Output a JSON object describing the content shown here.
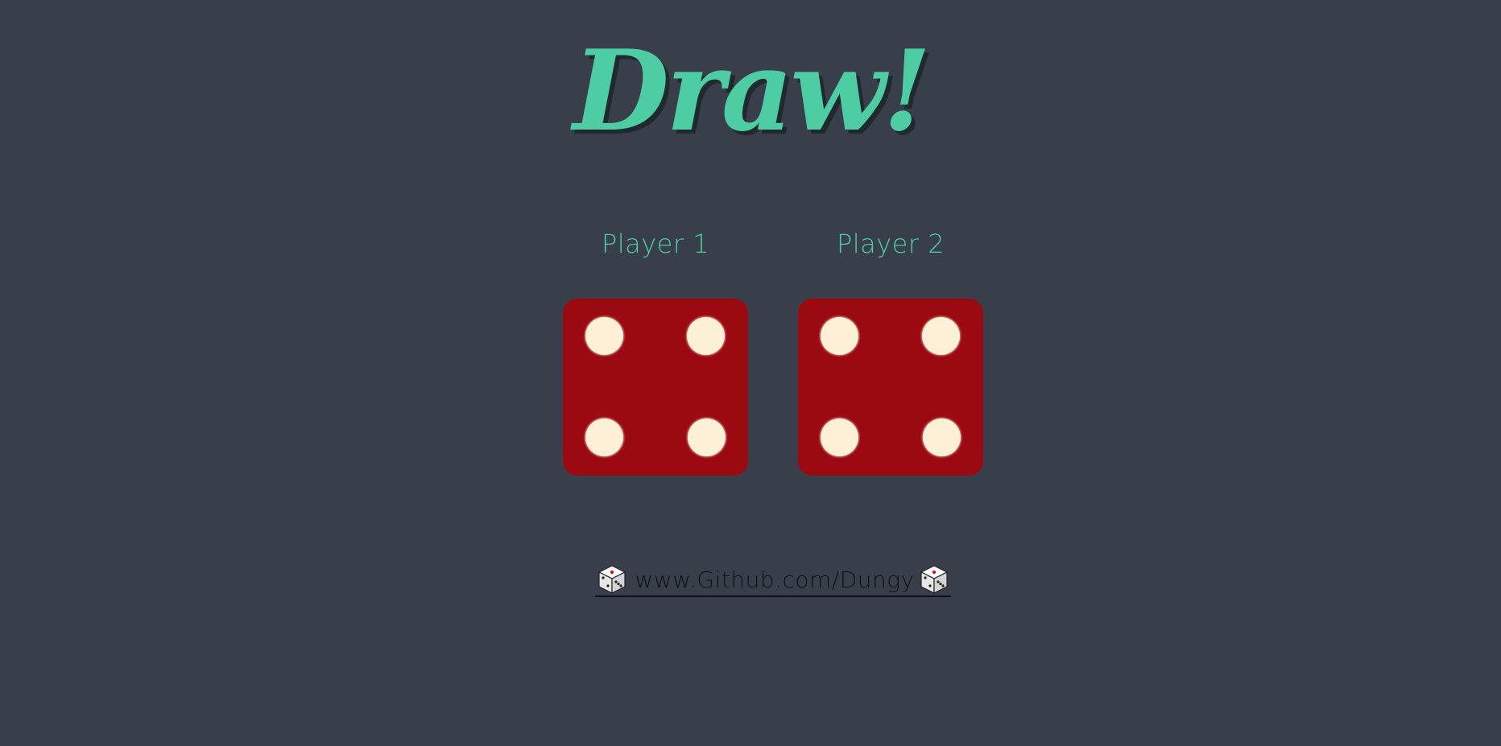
{
  "header": {
    "title": "Draw!"
  },
  "players": [
    {
      "label": "Player 1",
      "die_value": 4
    },
    {
      "label": "Player 2",
      "die_value": 4
    }
  ],
  "footer": {
    "link_text": "www.Github.com/Dungy",
    "leading_icon": "dice-icon",
    "trailing_icon": "dice-icon"
  },
  "colors": {
    "background": "#393f4a",
    "accent": "#4ecca3",
    "die_face": "#9b0a10",
    "pip": "#fdf0d6"
  }
}
